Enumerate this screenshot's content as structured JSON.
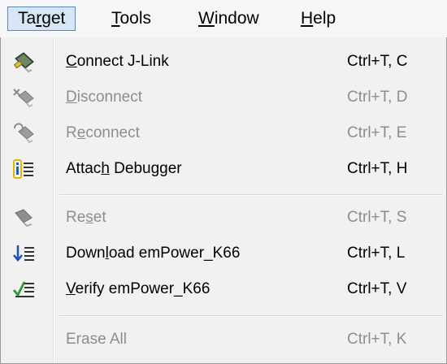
{
  "menubar": {
    "items": [
      {
        "pre": "Ta",
        "key": "r",
        "post": "get",
        "active": true
      },
      {
        "pre": "",
        "key": "T",
        "post": "ools",
        "active": false
      },
      {
        "pre": "",
        "key": "W",
        "post": "indow",
        "active": false
      },
      {
        "pre": "",
        "key": "H",
        "post": "elp",
        "active": false
      }
    ]
  },
  "menu": {
    "items": [
      {
        "pre": "",
        "key": "C",
        "post": "onnect J-Link",
        "shortcut": "Ctrl+T, C",
        "enabled": true,
        "icon": "connect-jlink-icon"
      },
      {
        "pre": "",
        "key": "D",
        "post": "isconnect",
        "shortcut": "Ctrl+T, D",
        "enabled": false,
        "icon": "disconnect-icon"
      },
      {
        "pre": "R",
        "key": "e",
        "post": "connect",
        "shortcut": "Ctrl+T, E",
        "enabled": false,
        "icon": "reconnect-icon"
      },
      {
        "pre": "Attac",
        "key": "h",
        "post": " Debugger",
        "shortcut": "Ctrl+T, H",
        "enabled": true,
        "icon": "attach-debugger-icon"
      },
      {
        "pre": "Re",
        "key": "s",
        "post": "et",
        "shortcut": "Ctrl+T, S",
        "enabled": false,
        "icon": "reset-icon"
      },
      {
        "pre": "Down",
        "key": "l",
        "post": "oad emPower_K66",
        "shortcut": "Ctrl+T, L",
        "enabled": true,
        "icon": "download-icon"
      },
      {
        "pre": "",
        "key": "V",
        "post": "erify emPower_K66",
        "shortcut": "Ctrl+T, V",
        "enabled": true,
        "icon": "verify-icon"
      },
      {
        "pre": "Erase All",
        "key": "",
        "post": "",
        "shortcut": "Ctrl+T, K",
        "enabled": false,
        "icon": "erase-all-icon"
      }
    ]
  },
  "colors": {
    "active_menu_bg": "#d6e6f7",
    "active_menu_border": "#5b86b8",
    "disabled_text": "#8d8d8d"
  }
}
